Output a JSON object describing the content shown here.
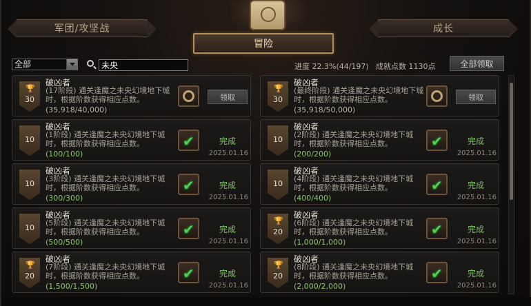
{
  "tabs": {
    "left": "军团/攻坚战",
    "active": "冒险",
    "right": "成长"
  },
  "filter": {
    "selected": "全部"
  },
  "search": {
    "value": "未央"
  },
  "summary": {
    "progress": "进度 22.3%(44/197)",
    "points": "成就点数 1130点",
    "claim_all": "全部领取"
  },
  "cards": [
    {
      "name": "破凶者",
      "desc": "(17阶段) 通关逢魔之未央幻境地下城时，根据阶数获得相应点数。",
      "progress": "(35,918/40,000)",
      "points": "30",
      "trophy": true,
      "state": "claim",
      "action": "领取",
      "date": ""
    },
    {
      "name": "破凶者",
      "desc": "(最终阶段) 通关逢魔之未央幻境地下城时，根据阶数获得相应点数。",
      "progress": "(35,918/50,000)",
      "points": "30",
      "trophy": true,
      "state": "claim",
      "action": "领取",
      "date": ""
    },
    {
      "name": "破凶者",
      "desc": "(1阶段) 通关逢魔之未央幻境地下城时，根据阶数获得相应点数。",
      "progress": "(100/100)",
      "points": "10",
      "trophy": false,
      "state": "done",
      "action": "完成",
      "date": "2025.01.16"
    },
    {
      "name": "破凶者",
      "desc": "(2阶段) 通关逢魔之未央幻境地下城时，根据阶数获得相应点数。",
      "progress": "(200/200)",
      "points": "10",
      "trophy": false,
      "state": "done",
      "action": "完成",
      "date": "2025.01.16"
    },
    {
      "name": "破凶者",
      "desc": "(3阶段) 通关逢魔之未央幻境地下城时，根据阶数获得相应点数。",
      "progress": "(300/300)",
      "points": "10",
      "trophy": false,
      "state": "done",
      "action": "完成",
      "date": "2025.01.16"
    },
    {
      "name": "破凶者",
      "desc": "(4阶段) 通关逢魔之未央幻境地下城时，根据阶数获得相应点数。",
      "progress": "(400/400)",
      "points": "10",
      "trophy": false,
      "state": "done",
      "action": "完成",
      "date": "2025.01.16"
    },
    {
      "name": "破凶者",
      "desc": "(5阶段) 通关逢魔之未央幻境地下城时，根据阶数获得相应点数。",
      "progress": "(500/500)",
      "points": "10",
      "trophy": false,
      "state": "done",
      "action": "完成",
      "date": "2025.01.16"
    },
    {
      "name": "破凶者",
      "desc": "(6阶段) 通关逢魔之未央幻境地下城时，根据阶数获得相应点数。",
      "progress": "(1,000/1,000)",
      "points": "20",
      "trophy": true,
      "state": "done",
      "action": "完成",
      "date": "2025.01.16"
    },
    {
      "name": "破凶者",
      "desc": "(7阶段) 通关逢魔之未央幻境地下城时，根据阶数获得相应点数。",
      "progress": "(1,500/1,500)",
      "points": "20",
      "trophy": true,
      "state": "done",
      "action": "完成",
      "date": "2025.01.16"
    },
    {
      "name": "破凶者",
      "desc": "(8阶段) 通关逢魔之未央幻境地下城时，根据阶数获得相应点数。",
      "progress": "(2,000/2,000)",
      "points": "20",
      "trophy": true,
      "state": "done",
      "action": "完成",
      "date": "2025.01.16"
    }
  ],
  "icons": {
    "trophy": "trophy-icon",
    "search": "search-icon",
    "dropdown": "chevron-down-icon",
    "reward": "reward-emblem-icon",
    "check": "check-icon"
  },
  "colors": {
    "done_green": "#7cc95a",
    "progress_green": "#8ec36a",
    "gold_border": "#b38d5a"
  }
}
